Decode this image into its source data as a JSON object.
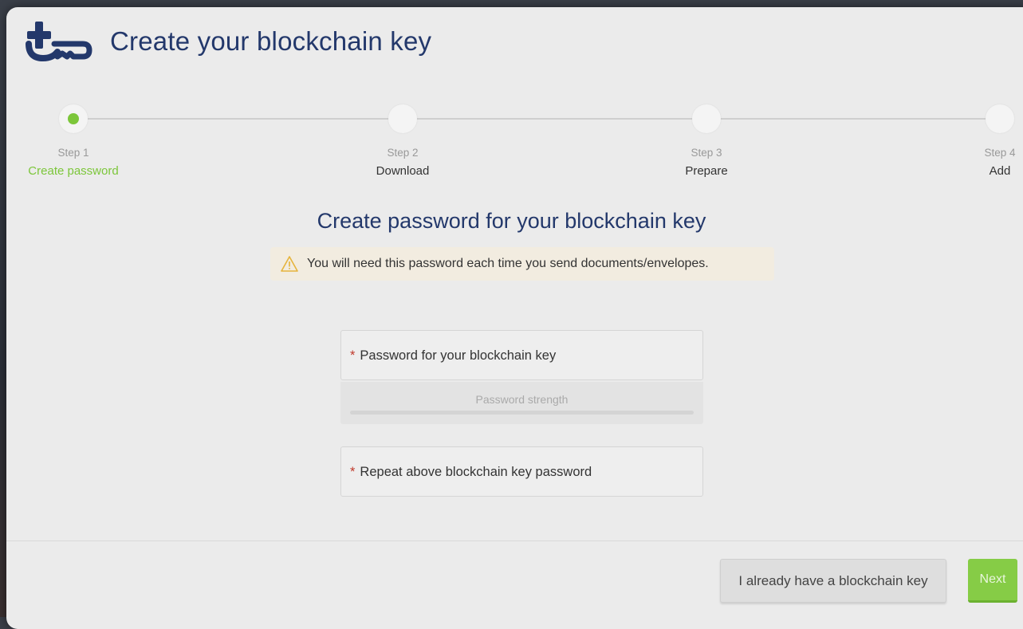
{
  "header": {
    "title": "Create your blockchain key",
    "logo_icon": "cross-key-logo-icon"
  },
  "stepper": {
    "steps": [
      {
        "number": "Step 1",
        "label": "Create password",
        "active": true
      },
      {
        "number": "Step 2",
        "label": "Download",
        "active": false
      },
      {
        "number": "Step 3",
        "label": "Prepare",
        "active": false
      },
      {
        "number": "Step 4",
        "label": "Add",
        "active": false
      }
    ]
  },
  "main": {
    "section_title": "Create password for your blockchain key",
    "warning_text": "You will need this password each time you send documents/envelopes.",
    "password_field": {
      "required_mark": "*",
      "label": "Password for your blockchain key",
      "value": ""
    },
    "strength_label": "Password strength",
    "strength_value": 0,
    "repeat_field": {
      "required_mark": "*",
      "label": "Repeat above blockchain key password",
      "value": ""
    }
  },
  "footer": {
    "existing_key_label": "I already have a blockchain key",
    "next_label": "Next"
  },
  "colors": {
    "accent_green": "#7cc63a",
    "title_blue": "#23386b",
    "required_red": "#c0392b",
    "warning_bg": "#f2ece0"
  }
}
